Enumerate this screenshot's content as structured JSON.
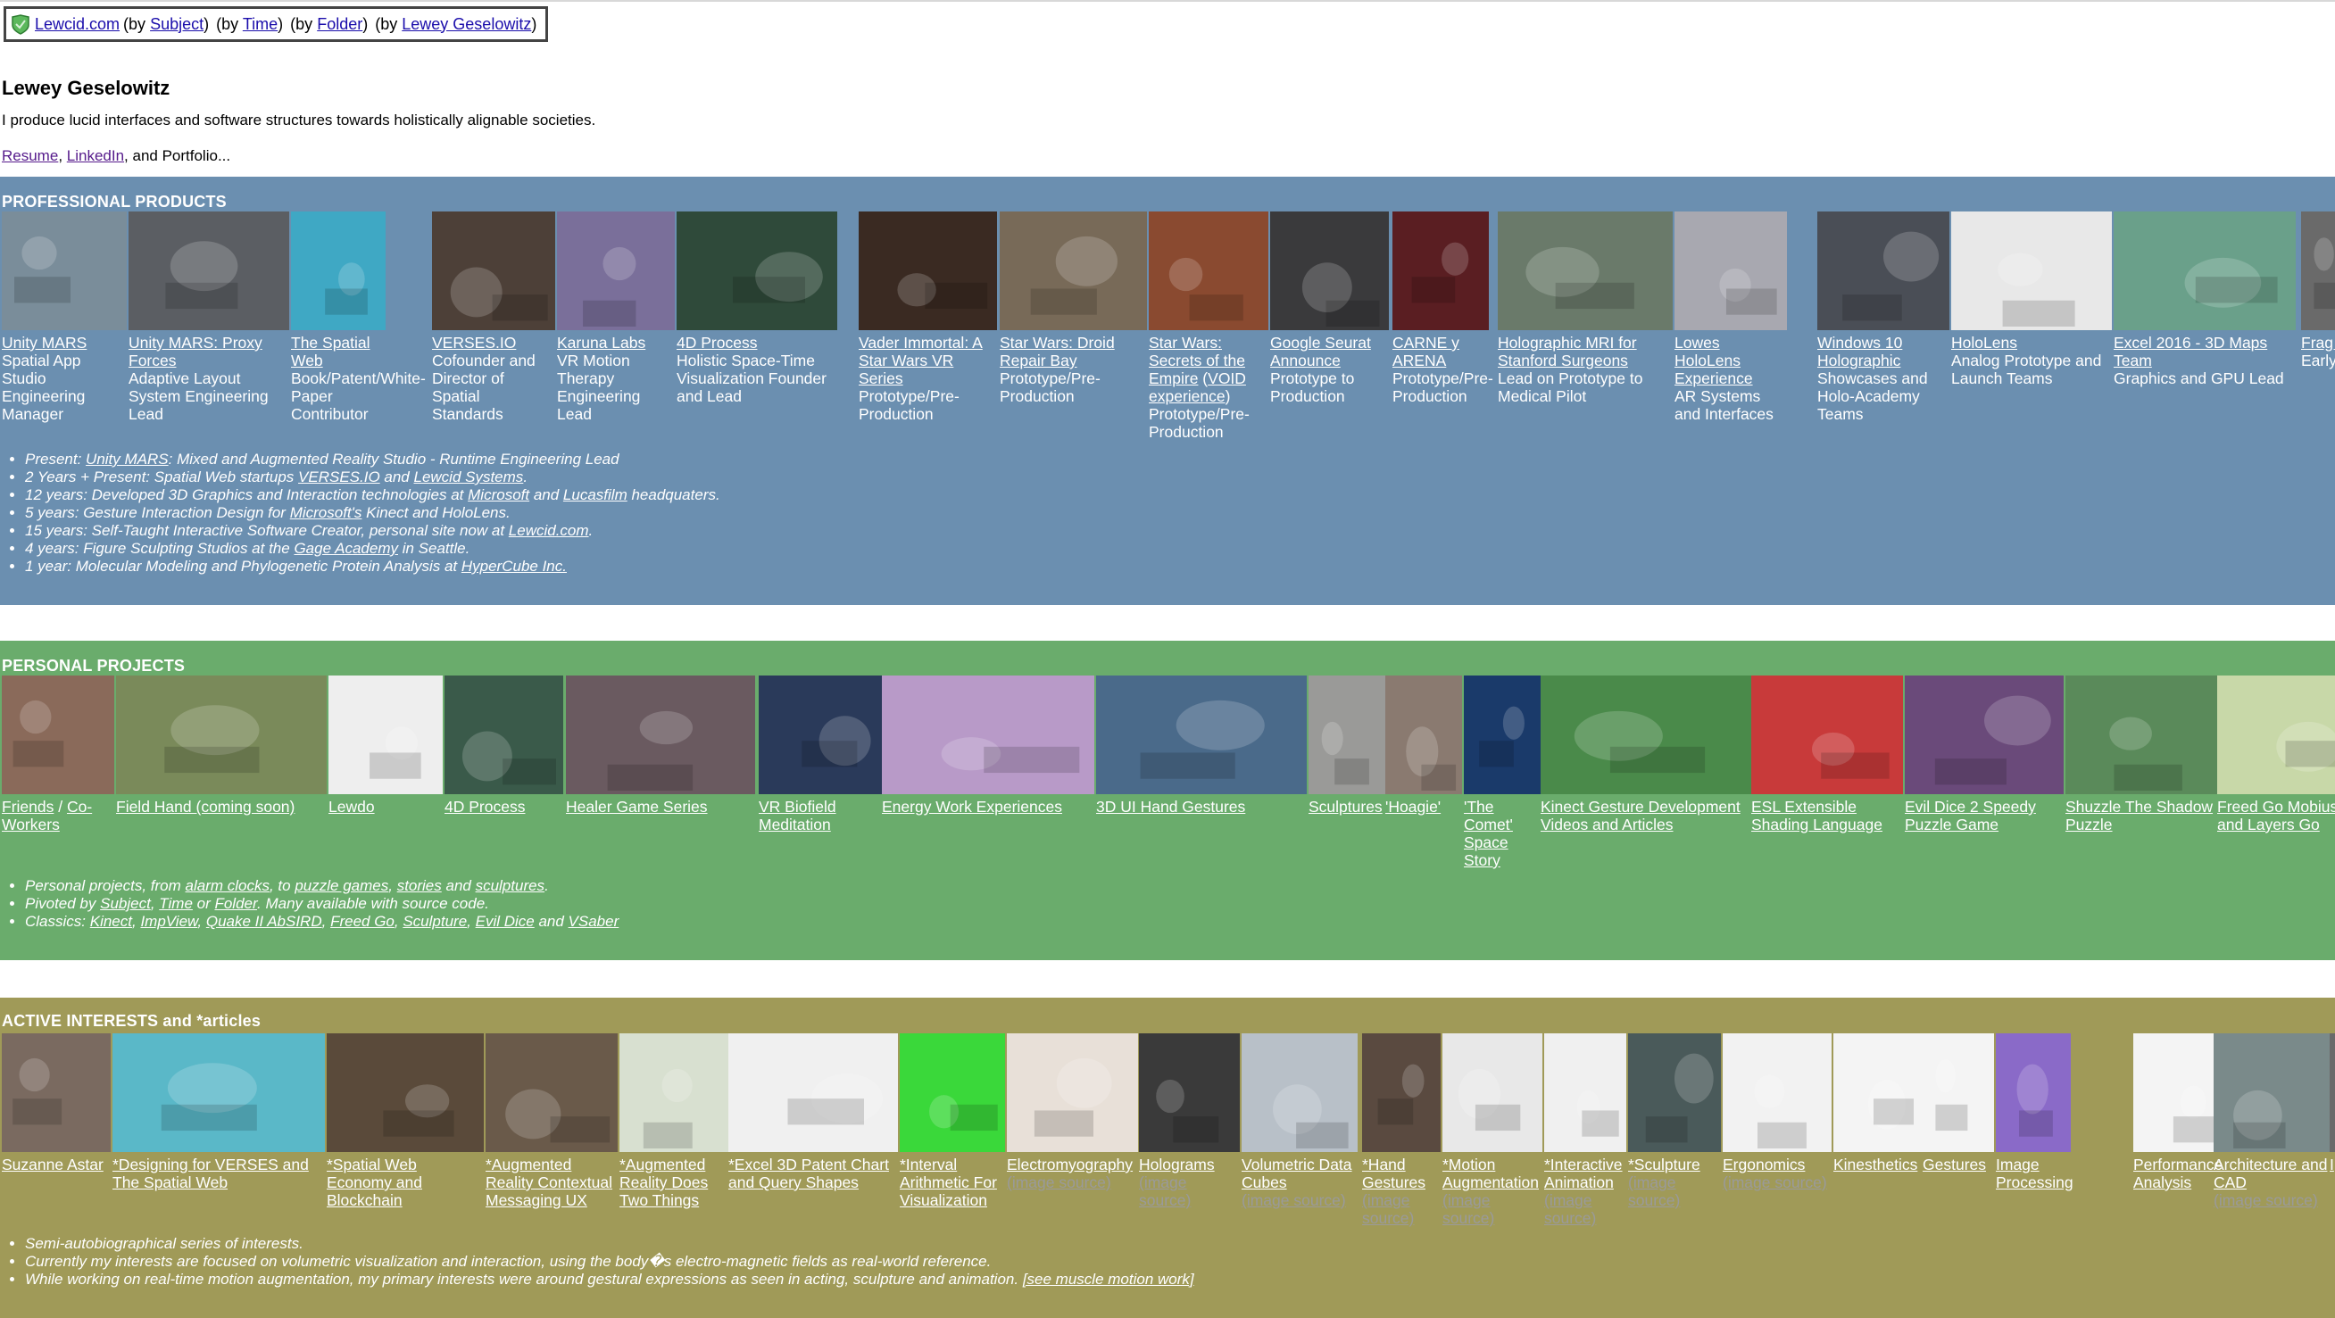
{
  "header": {
    "breadcrumb": {
      "home": "Lewcid.com",
      "subject": "Subject",
      "time": "Time",
      "folder": "Folder",
      "person": "Lewey Geselowitz",
      "by": "(by",
      "close": ")"
    },
    "name": "Lewey Geselowitz",
    "tagline": "I produce lucid interfaces and software structures towards holistically alignable societies.",
    "links": {
      "resume": "Resume",
      "linkedin": "LinkedIn",
      "portfolio": ", and Portfolio...",
      "comma": ", "
    }
  },
  "professional": {
    "title": "PROFESSIONAL PRODUCTS",
    "color": "#6b8fb0",
    "tiles": [
      {
        "link": "Unity MARS",
        "desc": "Spatial App Studio Engineering Manager",
        "thumb": "#7a8d9a"
      },
      {
        "link": "Unity MARS: Proxy Forces",
        "desc": "Adaptive Layout System Engineering Lead",
        "thumb": "#5b5e63"
      },
      {
        "link": "The Spatial Web",
        "desc": "Book/Patent/White-Paper Contributor",
        "thumb": "#3fa8c4"
      },
      {
        "link": "VERSES.IO",
        "desc": "Cofounder and Director of Spatial Standards",
        "thumb": "#4d4038"
      },
      {
        "link": "Karuna Labs",
        "desc": "VR Motion Therapy Engineering Lead",
        "thumb": "#7a6f9a"
      },
      {
        "link": "4D Process",
        "desc": "Holistic Space-Time Visualization Founder and Lead",
        "thumb": "#2f4a3a"
      },
      {
        "link": "Vader Immortal: A Star Wars VR Series",
        "desc": "Prototype/Pre-Production",
        "thumb": "#3a2a22"
      },
      {
        "link": "Star Wars: Droid Repair Bay",
        "desc": "Prototype/Pre-Production",
        "thumb": "#786a58"
      },
      {
        "link": "Star Wars: Secrets of the Empire",
        "link2": "VOID experience",
        "desc": "Prototype/Pre-Production",
        "thumb": "#8a4a30"
      },
      {
        "link": "Google Seurat Announce",
        "desc": "Prototype to Production",
        "thumb": "#3a3a3c"
      },
      {
        "link": "CARNE y ARENA",
        "desc": "Prototype/Pre-Production",
        "thumb": "#5a1e22"
      },
      {
        "link": "Holographic MRI for Stanford Surgeons",
        "desc": "Lead on Prototype to Medical Pilot",
        "thumb": "#6a7a6a"
      },
      {
        "link": "Lowes HoloLens Experience",
        "desc": "AR Systems and Interfaces",
        "thumb": "#a8a8b0"
      },
      {
        "link": "Windows 10 Holographic",
        "desc": "Showcases and Holo-Academy Teams",
        "thumb": "#4a4e56"
      },
      {
        "link": "HoloLens",
        "desc": "Analog Prototype and Launch Teams",
        "thumb": "#e8e8e8"
      },
      {
        "link": "Excel 2016 - 3D Maps Team",
        "desc": "Graphics and GPU Lead",
        "thumb": "#6aa08a"
      },
      {
        "link": "Frag (Hol",
        "desc": "Early and",
        "thumb": "#6a6a6a"
      }
    ],
    "bullets": [
      {
        "pre": "Present: ",
        "links": [
          "Unity MARS"
        ],
        "post": ": Mixed and Augmented Reality Studio - Runtime Engineering Lead"
      },
      {
        "pre": "2 Years + Present: Spatial Web startups ",
        "links": [
          "VERSES.IO",
          "Lewcid Systems"
        ],
        "mid": " and ",
        "post": "."
      },
      {
        "pre": "12 years: Developed 3D Graphics and Interaction technologies at ",
        "links": [
          "Microsoft",
          "Lucasfilm"
        ],
        "mid": " and ",
        "post": " headquaters."
      },
      {
        "pre": "5 years: Gesture Interaction Design for ",
        "links": [
          "Microsoft's"
        ],
        "post": " Kinect and HoloLens."
      },
      {
        "pre": "15 years: Self-Taught Interactive Software Creator, personal site now at ",
        "links": [
          "Lewcid.com"
        ],
        "post": "."
      },
      {
        "pre": "4 years: Figure Sculpting Studios at the ",
        "links": [
          "Gage Academy"
        ],
        "post": " in Seattle."
      },
      {
        "pre": "1 year: Molecular Modeling and Phylogenetic Protein Analysis at ",
        "links": [
          "HyperCube Inc."
        ],
        "post": ""
      }
    ]
  },
  "personal": {
    "title": "PERSONAL PROJECTS",
    "color": "#6aac6c",
    "tiles": [
      {
        "link": "Friends",
        "sep": " / ",
        "link2": "Co-Workers",
        "thumb": "#8a6a5a"
      },
      {
        "link": "Field Hand (coming soon)",
        "thumb": "#7a8a5a"
      },
      {
        "link": "Lewdo",
        "thumb": "#eeeeee"
      },
      {
        "link": "4D Process",
        "thumb": "#3a5a4a"
      },
      {
        "link": "Healer Game Series",
        "thumb": "#6a5a60"
      },
      {
        "link": "VR Biofield Meditation",
        "thumb": "#2a3a5a"
      },
      {
        "link": "Energy Work Experiences",
        "thumb": "#b89ac8"
      },
      {
        "link": "3D UI Hand Gestures",
        "thumb": "#4a6a8a"
      },
      {
        "link": "Sculptures",
        "thumb": "#9a9a98"
      },
      {
        "link": "'Hoagie'",
        "thumb": "#8a7a70"
      },
      {
        "link": "'The Comet' Space Story",
        "thumb": "#1a3a6a"
      },
      {
        "link": "Kinect Gesture Development Videos and Articles",
        "thumb": "#4a8a4a"
      },
      {
        "link": "ESL Extensible Shading Language",
        "thumb": "#c83a3a"
      },
      {
        "link": "Evil Dice 2 Speedy Puzzle Game",
        "thumb": "#6a4a7a"
      },
      {
        "link": "Shuzzle The Shadow Puzzle",
        "thumb": "#5a8a5a"
      },
      {
        "link": "Freed Go Mobius and Layers Go",
        "thumb": "#c8d8a8"
      }
    ],
    "bullets": [
      {
        "pre": "Personal projects, from ",
        "links": [
          "alarm clocks",
          "puzzle games",
          "stories",
          "sculptures"
        ],
        "seps": [
          ", to ",
          ", ",
          " and "
        ],
        "post": "."
      },
      {
        "pre": "Pivoted by ",
        "links": [
          "Subject",
          "Time",
          "Folder"
        ],
        "seps": [
          ", ",
          " or "
        ],
        "post": ". Many available with source code."
      },
      {
        "pre": "Classics: ",
        "links": [
          "Kinect",
          "ImpView",
          "Quake II AbSIRD",
          "Freed Go",
          "Sculpture",
          "Evil Dice",
          "VSaber"
        ],
        "seps": [
          ", ",
          ", ",
          ", ",
          ", ",
          ", ",
          " and "
        ],
        "post": ""
      }
    ]
  },
  "interests": {
    "title": "ACTIVE INTERESTS and *articles",
    "color": "#a09a58",
    "tiles": [
      {
        "link": "Suzanne Astar",
        "thumb": "#7a6a60"
      },
      {
        "link": "*Designing for VERSES and The Spatial Web",
        "thumb": "#5ab8c8"
      },
      {
        "link": "*Spatial Web Economy and Blockchain",
        "thumb": "#5a4a3a"
      },
      {
        "link": "*Augmented Reality Contextual Messaging UX",
        "thumb": "#6a5a4a"
      },
      {
        "link": "*Augmented Reality Does Two Things",
        "thumb": "#d8e0d0"
      },
      {
        "link": "*Excel 3D Patent Chart and Query Shapes",
        "thumb": "#f0f0f0"
      },
      {
        "link": "*Interval Arithmetic For Visualization",
        "thumb": "#3ad83a"
      },
      {
        "link": "Electromyography",
        "src": "(image source)",
        "thumb": "#e8e0d8"
      },
      {
        "link": "Holograms",
        "src": "(image source)",
        "thumb": "#3a3a3a"
      },
      {
        "link": "Volumetric Data Cubes",
        "src": "(image source)",
        "thumb": "#b8c0c8"
      },
      {
        "link": "*Hand Gestures",
        "src": "(image source)",
        "thumb": "#5a4a40"
      },
      {
        "link": "*Motion Augmentation",
        "src": "(image source)",
        "thumb": "#e8e8e8"
      },
      {
        "link": "*Interactive Animation",
        "src": "(image source)",
        "thumb": "#f0f0f0"
      },
      {
        "link": "*Sculpture",
        "src": "(image source)",
        "thumb": "#4a5a5a"
      },
      {
        "link": "Ergonomics",
        "src": "(image source)",
        "thumb": "#f2f2f2"
      },
      {
        "link": "Kinesthetics",
        "thumb": "#f4f4f4"
      },
      {
        "link": "Gestures",
        "thumb": "#f4f4f4"
      },
      {
        "link": "Image Processing",
        "thumb": "#8a6ac8"
      },
      {
        "link": "Performance Analysis",
        "thumb": "#f4f4f4"
      },
      {
        "link": "Architecture and CAD",
        "src": "(image source)",
        "thumb": "#7a8a8a"
      },
      {
        "link": "I",
        "thumb": "#6a6a6a"
      }
    ],
    "bullets": [
      {
        "pre": "Semi-autobiographical series of interests.",
        "links": [],
        "post": ""
      },
      {
        "pre": "Currently my interests are focused on volumetric visualization and interaction, using the body�s electro-magnetic fields as real-world reference.",
        "links": [],
        "post": ""
      },
      {
        "pre": "While working on real-time motion augmentation, my primary interests were around gestural expressions as seen in acting, sculpture and animation. ",
        "links": [
          "[see muscle motion work]"
        ],
        "post": ""
      }
    ]
  }
}
